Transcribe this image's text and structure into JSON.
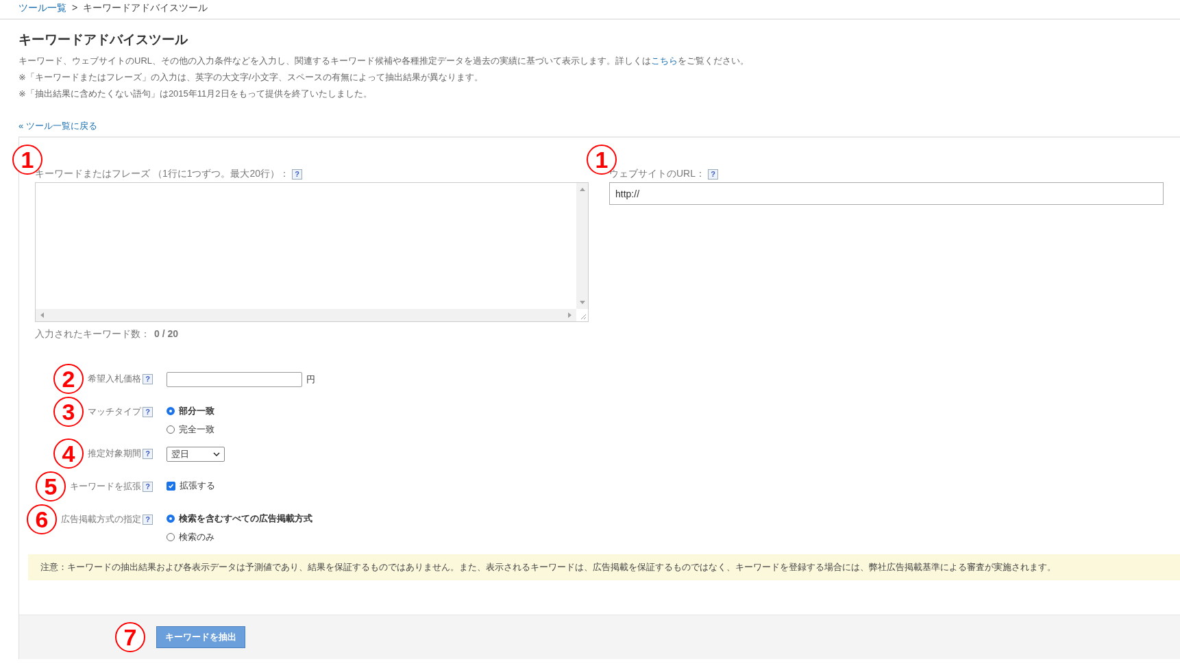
{
  "breadcrumb": {
    "link": "ツール一覧",
    "separator": ">",
    "current": "キーワードアドバイスツール"
  },
  "title": "キーワードアドバイスツール",
  "description": [
    {
      "text": "キーワード、ウェブサイトのURL、その他の入力条件などを入力し、関連するキーワード候補や各種推定データを過去の実績に基づいて表示します。詳しくは",
      "link": "こちら",
      "after": "をご覧ください。"
    },
    {
      "text": "※「キーワードまたはフレーズ」の入力は、英字の大文字/小文字、スペースの有無によって抽出結果が異なります。"
    },
    {
      "text": "※「抽出結果に含めたくない語句」は2015年11月2日をもって提供を終了いたしました。"
    }
  ],
  "back_link": "« ツール一覧に戻る",
  "keywords": {
    "marker": "1",
    "label": "キーワードまたはフレーズ （1行に1つずつ。最大20行）：",
    "help": "?",
    "count_label": "入力されたキーワード数：",
    "count": "0 / 20"
  },
  "website": {
    "marker": "1",
    "label": "ウェブサイトのURL：",
    "help": "?",
    "value": "http://"
  },
  "options": [
    {
      "kind": "text",
      "marker": "2",
      "label": "希望入札価格",
      "help": "?",
      "unit": "円"
    },
    {
      "kind": "radio",
      "marker": "3",
      "label": "マッチタイプ",
      "help": "?",
      "choices": [
        {
          "label": "部分一致",
          "selected": true
        },
        {
          "label": "完全一致",
          "selected": false
        }
      ]
    },
    {
      "kind": "select",
      "marker": "4",
      "label": "推定対象期間",
      "help": "?",
      "value": "翌日"
    },
    {
      "kind": "checkbox",
      "marker": "5",
      "label": "キーワードを拡張",
      "help": "?",
      "checkbox": {
        "label": "拡張する",
        "checked": true
      }
    },
    {
      "kind": "radio",
      "marker": "6",
      "label": "広告掲載方式の指定",
      "help": "?",
      "choices": [
        {
          "label": "検索を含むすべての広告掲載方式",
          "selected": true
        },
        {
          "label": "検索のみ",
          "selected": false
        }
      ]
    }
  ],
  "notice": "注意：キーワードの抽出結果および各表示データは予測値であり、結果を保証するものではありません。また、表示されるキーワードは、広告掲載を保証するものではなく、キーワードを登録する場合には、弊社広告掲載基準による審査が実施されます。",
  "submit": {
    "marker": "7",
    "label": "キーワードを抽出"
  }
}
